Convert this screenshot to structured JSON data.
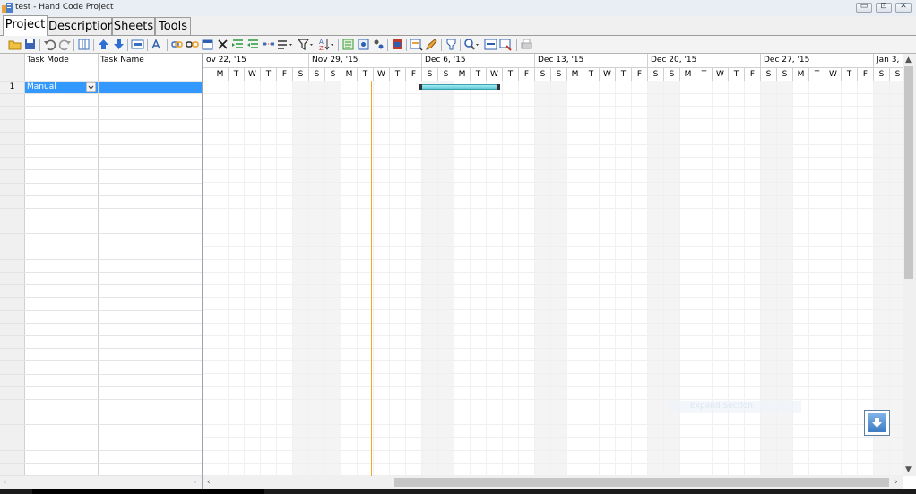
{
  "window": {
    "title": "test - Hand Code Project",
    "buttons": {
      "minimize": "▭",
      "maximize": "⊡",
      "close": "✕"
    }
  },
  "tabs": [
    {
      "label": "Project",
      "active": true
    },
    {
      "label": "Description",
      "active": false
    },
    {
      "label": "Sheets",
      "active": false
    },
    {
      "label": "Tools",
      "active": false
    }
  ],
  "toolbar_icons": [
    "open-folder-icon",
    "save-icon",
    "undo-icon",
    "redo-icon",
    "columns-icon",
    "move-up-icon",
    "move-down-icon",
    "task-info-icon",
    "spell-check-icon",
    "link-tasks-icon",
    "unlink-tasks-icon",
    "calendar-icon",
    "delete-icon",
    "indent-icon",
    "outdent-icon",
    "split-task-icon",
    "task-type-icon",
    "filter-icon",
    "sort-icon",
    "notes-icon",
    "resources-icon",
    "assign-icon",
    "critical-path-icon",
    "scroll-to-task-icon",
    "edit-icon",
    "highlight-icon",
    "zoom-icon",
    "fit-icon",
    "print-preview-icon",
    "print-icon"
  ],
  "grid": {
    "columns": {
      "task_mode": "Task Mode",
      "task_name": "Task Name"
    },
    "rows": [
      {
        "number": "1",
        "task_mode": "Manual",
        "task_name": ""
      }
    ]
  },
  "timeline": {
    "weeks": [
      "ov 22, '15",
      "Nov 29, '15",
      "Dec 6, '15",
      "Dec 13, '15",
      "Dec 20, '15",
      "Dec 27, '15",
      "Jan 3, '16"
    ],
    "first_week_days": [
      "M",
      "T",
      "W",
      "T",
      "F",
      "S",
      "S"
    ],
    "week_days": [
      "S",
      "M",
      "T",
      "W",
      "T",
      "F",
      "S"
    ],
    "last_week_days": [
      "S",
      "M"
    ],
    "today_line_color": "#f5a623",
    "task_bar": {
      "start": "Dec 6, '15",
      "end": "Dec 10, '15",
      "color": "#5ec8d6"
    }
  },
  "overlay": {
    "ghost_text": "Expand Section"
  }
}
